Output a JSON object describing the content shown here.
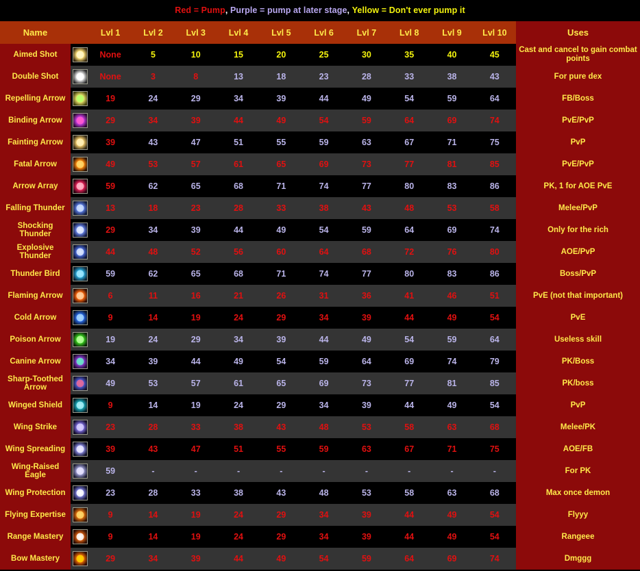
{
  "legend": {
    "parts": [
      {
        "text": "Red = Pump",
        "color": "#e01010"
      },
      {
        "text": ", ",
        "color": "#ffffff"
      },
      {
        "text": "Purple = pump at later stage",
        "color": "#b9a8f0"
      },
      {
        "text": ", ",
        "color": "#ffffff"
      },
      {
        "text": "Yellow = Don't ever pump it",
        "color": "#f3f30e"
      }
    ],
    "full_text": "Red = Pump, Purple = pump at later stage, Yellow = Don't ever pump it"
  },
  "colors": {
    "header_bg": "#a83008",
    "name_col_bg": "#8c0a0a",
    "uses_col_bg": "#8c0a0a",
    "row_dark": "#000000",
    "row_light": "#343434",
    "header_text": "#ffe94a",
    "red": "#e01010",
    "purple": "#b9b3e8",
    "yellow": "#f3f30e"
  },
  "header": {
    "name": "Name",
    "levels": [
      "Lvl 1",
      "Lvl 2",
      "Lvl 3",
      "Lvl 4",
      "Lvl 5",
      "Lvl 6",
      "Lvl 7",
      "Lvl 8",
      "Lvl 9",
      "Lvl 10"
    ],
    "uses": "Uses"
  },
  "rows": [
    {
      "name": "Aimed Shot",
      "icon": "aimed-shot-icon",
      "icon_colors": [
        "#3a2b10",
        "#ffe27a",
        "#fff6c8"
      ],
      "values": [
        "None",
        "5",
        "10",
        "15",
        "20",
        "25",
        "30",
        "35",
        "40",
        "45"
      ],
      "value_colors": [
        "red",
        "yellow",
        "yellow",
        "yellow",
        "yellow",
        "yellow",
        "yellow",
        "yellow",
        "yellow",
        "yellow"
      ],
      "uses": "Cast and cancel to gain combat points"
    },
    {
      "name": "Double Shot",
      "icon": "double-shot-icon",
      "icon_colors": [
        "#2b2b2b",
        "#e8e8e8",
        "#ffffff"
      ],
      "values": [
        "None",
        "3",
        "8",
        "13",
        "18",
        "23",
        "28",
        "33",
        "38",
        "43"
      ],
      "value_colors": [
        "red",
        "red",
        "red",
        "purple",
        "purple",
        "purple",
        "purple",
        "purple",
        "purple",
        "purple"
      ],
      "uses": "For pure dex"
    },
    {
      "name": "Repelling Arrow",
      "icon": "repelling-arrow-icon",
      "icon_colors": [
        "#43400f",
        "#e8e06a",
        "#b6ff6a"
      ],
      "values": [
        "19",
        "24",
        "29",
        "34",
        "39",
        "44",
        "49",
        "54",
        "59",
        "64"
      ],
      "value_colors": [
        "red",
        "purple",
        "purple",
        "purple",
        "purple",
        "purple",
        "purple",
        "purple",
        "purple",
        "purple"
      ],
      "uses": "FB/Boss"
    },
    {
      "name": "Binding Arrow",
      "icon": "binding-arrow-icon",
      "icon_colors": [
        "#2a0a30",
        "#c53de0",
        "#ff5ad0"
      ],
      "values": [
        "29",
        "34",
        "39",
        "44",
        "49",
        "54",
        "59",
        "64",
        "69",
        "74"
      ],
      "value_colors": [
        "red",
        "red",
        "red",
        "red",
        "red",
        "red",
        "red",
        "red",
        "red",
        "red"
      ],
      "uses": "PvE/PvP"
    },
    {
      "name": "Fainting Arrow",
      "icon": "fainting-arrow-icon",
      "icon_colors": [
        "#2f2614",
        "#f0c96a",
        "#fff0b8"
      ],
      "values": [
        "39",
        "43",
        "47",
        "51",
        "55",
        "59",
        "63",
        "67",
        "71",
        "75"
      ],
      "value_colors": [
        "red",
        "purple",
        "purple",
        "purple",
        "purple",
        "purple",
        "purple",
        "purple",
        "purple",
        "purple"
      ],
      "uses": "PvP"
    },
    {
      "name": "Fatal Arrow",
      "icon": "fatal-arrow-icon",
      "icon_colors": [
        "#2a1000",
        "#ff8a10",
        "#ffd86a"
      ],
      "values": [
        "49",
        "53",
        "57",
        "61",
        "65",
        "69",
        "73",
        "77",
        "81",
        "85"
      ],
      "value_colors": [
        "red",
        "red",
        "red",
        "red",
        "red",
        "red",
        "red",
        "red",
        "red",
        "red"
      ],
      "uses": "PvE/PvP"
    },
    {
      "name": "Arrow Array",
      "icon": "arrow-array-icon",
      "icon_colors": [
        "#2a0010",
        "#e8235a",
        "#ffb6c8"
      ],
      "values": [
        "59",
        "62",
        "65",
        "68",
        "71",
        "74",
        "77",
        "80",
        "83",
        "86"
      ],
      "value_colors": [
        "red",
        "purple",
        "purple",
        "purple",
        "purple",
        "purple",
        "purple",
        "purple",
        "purple",
        "purple"
      ],
      "uses": "PK, 1 for AOE PvE"
    },
    {
      "name": "Falling Thunder",
      "icon": "falling-thunder-icon",
      "icon_colors": [
        "#101a38",
        "#5a7ae0",
        "#cfe0ff"
      ],
      "values": [
        "13",
        "18",
        "23",
        "28",
        "33",
        "38",
        "43",
        "48",
        "53",
        "58"
      ],
      "value_colors": [
        "red",
        "red",
        "red",
        "red",
        "red",
        "red",
        "red",
        "red",
        "red",
        "red"
      ],
      "uses": "Melee/PvP"
    },
    {
      "name": "Shocking Thunder",
      "icon": "shocking-thunder-icon",
      "icon_colors": [
        "#0e1438",
        "#6a86ea",
        "#e4ecff"
      ],
      "values": [
        "29",
        "34",
        "39",
        "44",
        "49",
        "54",
        "59",
        "64",
        "69",
        "74"
      ],
      "value_colors": [
        "red",
        "purple",
        "purple",
        "purple",
        "purple",
        "purple",
        "purple",
        "purple",
        "purple",
        "purple"
      ],
      "uses": "Only for the rich"
    },
    {
      "name": "Explosive Thunder",
      "icon": "explosive-thunder-icon",
      "icon_colors": [
        "#0c1230",
        "#4a6ad8",
        "#dce8ff"
      ],
      "values": [
        "44",
        "48",
        "52",
        "56",
        "60",
        "64",
        "68",
        "72",
        "76",
        "80"
      ],
      "value_colors": [
        "red",
        "red",
        "red",
        "red",
        "red",
        "red",
        "red",
        "red",
        "red",
        "red"
      ],
      "uses": "AOE/PvP"
    },
    {
      "name": "Thunder Bird",
      "icon": "thunder-bird-icon",
      "icon_colors": [
        "#0a2030",
        "#2aa8d8",
        "#9fe8ff"
      ],
      "values": [
        "59",
        "62",
        "65",
        "68",
        "71",
        "74",
        "77",
        "80",
        "83",
        "86"
      ],
      "value_colors": [
        "purple",
        "purple",
        "purple",
        "purple",
        "purple",
        "purple",
        "purple",
        "purple",
        "purple",
        "purple"
      ],
      "uses": "Boss/PvP"
    },
    {
      "name": "Flaming Arrow",
      "icon": "flaming-arrow-icon",
      "icon_colors": [
        "#2e0a00",
        "#ff6a10",
        "#ffd0a0"
      ],
      "values": [
        "6",
        "11",
        "16",
        "21",
        "26",
        "31",
        "36",
        "41",
        "46",
        "51"
      ],
      "value_colors": [
        "red",
        "red",
        "red",
        "red",
        "red",
        "red",
        "red",
        "red",
        "red",
        "red"
      ],
      "uses": "PvE (not that important)"
    },
    {
      "name": "Cold Arrow",
      "icon": "cold-arrow-icon",
      "icon_colors": [
        "#061428",
        "#2a6ae8",
        "#a8d8ff"
      ],
      "values": [
        "9",
        "14",
        "19",
        "24",
        "29",
        "34",
        "39",
        "44",
        "49",
        "54"
      ],
      "value_colors": [
        "red",
        "red",
        "red",
        "red",
        "red",
        "red",
        "red",
        "red",
        "red",
        "red"
      ],
      "uses": "PvE"
    },
    {
      "name": "Poison Arrow",
      "icon": "poison-arrow-icon",
      "icon_colors": [
        "#0a2008",
        "#3ad020",
        "#b6ff9a"
      ],
      "values": [
        "19",
        "24",
        "29",
        "34",
        "39",
        "44",
        "49",
        "54",
        "59",
        "64"
      ],
      "value_colors": [
        "purple",
        "purple",
        "purple",
        "purple",
        "purple",
        "purple",
        "purple",
        "purple",
        "purple",
        "purple"
      ],
      "uses": "Useless skill"
    },
    {
      "name": "Canine Arrow",
      "icon": "canine-arrow-icon",
      "icon_colors": [
        "#1a0a2a",
        "#8a3ad0",
        "#6aeac8"
      ],
      "values": [
        "34",
        "39",
        "44",
        "49",
        "54",
        "59",
        "64",
        "69",
        "74",
        "79"
      ],
      "value_colors": [
        "purple",
        "purple",
        "purple",
        "purple",
        "purple",
        "purple",
        "purple",
        "purple",
        "purple",
        "purple"
      ],
      "uses": "PK/Boss"
    },
    {
      "name": "Sharp-Toothed Arrow",
      "icon": "sharp-toothed-arrow-icon",
      "icon_colors": [
        "#14102a",
        "#4a5ad0",
        "#e86a9a"
      ],
      "values": [
        "49",
        "53",
        "57",
        "61",
        "65",
        "69",
        "73",
        "77",
        "81",
        "85"
      ],
      "value_colors": [
        "purple",
        "purple",
        "purple",
        "purple",
        "purple",
        "purple",
        "purple",
        "purple",
        "purple",
        "purple"
      ],
      "uses": "PK/boss"
    },
    {
      "name": "Winged Shield",
      "icon": "winged-shield-icon",
      "icon_colors": [
        "#062028",
        "#1aa8b8",
        "#a8f0f8"
      ],
      "values": [
        "9",
        "14",
        "19",
        "24",
        "29",
        "34",
        "39",
        "44",
        "49",
        "54"
      ],
      "value_colors": [
        "red",
        "purple",
        "purple",
        "purple",
        "purple",
        "purple",
        "purple",
        "purple",
        "purple",
        "purple"
      ],
      "uses": "PvP"
    },
    {
      "name": "Wing Strike",
      "icon": "wing-strike-icon",
      "icon_colors": [
        "#0e0a24",
        "#7a6ad8",
        "#d8d0ff"
      ],
      "values": [
        "23",
        "28",
        "33",
        "38",
        "43",
        "48",
        "53",
        "58",
        "63",
        "68"
      ],
      "value_colors": [
        "red",
        "red",
        "red",
        "red",
        "red",
        "red",
        "red",
        "red",
        "red",
        "red"
      ],
      "uses": "Melee/PK"
    },
    {
      "name": "Wing Spreading",
      "icon": "wing-spreading-icon",
      "icon_colors": [
        "#0a0a1e",
        "#8a8ae0",
        "#eceaff"
      ],
      "values": [
        "39",
        "43",
        "47",
        "51",
        "55",
        "59",
        "63",
        "67",
        "71",
        "75"
      ],
      "value_colors": [
        "red",
        "red",
        "red",
        "red",
        "red",
        "red",
        "red",
        "red",
        "red",
        "red"
      ],
      "uses": "AOE/FB"
    },
    {
      "name": "Wing-Raised Eagle",
      "icon": "wing-raised-eagle-icon",
      "icon_colors": [
        "#1a1a2e",
        "#9a9ad0",
        "#e8e4ff"
      ],
      "values": [
        "59",
        "-",
        "-",
        "-",
        "-",
        "-",
        "-",
        "-",
        "-",
        "-"
      ],
      "value_colors": [
        "purple",
        "dash",
        "dash",
        "dash",
        "dash",
        "dash",
        "dash",
        "dash",
        "dash",
        "dash"
      ],
      "uses": "For PK"
    },
    {
      "name": "Wing Protection",
      "icon": "wing-protection-icon",
      "icon_colors": [
        "#0c0c24",
        "#7a7ad8",
        "#ffffff"
      ],
      "values": [
        "23",
        "28",
        "33",
        "38",
        "43",
        "48",
        "53",
        "58",
        "63",
        "68"
      ],
      "value_colors": [
        "purple",
        "purple",
        "purple",
        "purple",
        "purple",
        "purple",
        "purple",
        "purple",
        "purple",
        "purple"
      ],
      "uses": "Max once demon"
    },
    {
      "name": "Flying Expertise",
      "icon": "flying-expertise-icon",
      "icon_colors": [
        "#301000",
        "#e07010",
        "#ffd86a"
      ],
      "values": [
        "9",
        "14",
        "19",
        "24",
        "29",
        "34",
        "39",
        "44",
        "49",
        "54"
      ],
      "value_colors": [
        "red",
        "red",
        "red",
        "red",
        "red",
        "red",
        "red",
        "red",
        "red",
        "red"
      ],
      "uses": "Flyyy"
    },
    {
      "name": "Range Mastery",
      "icon": "range-mastery-icon",
      "icon_colors": [
        "#2a0c00",
        "#d05a10",
        "#ffffff"
      ],
      "values": [
        "9",
        "14",
        "19",
        "24",
        "29",
        "34",
        "39",
        "44",
        "49",
        "54"
      ],
      "value_colors": [
        "red",
        "red",
        "red",
        "red",
        "red",
        "red",
        "red",
        "red",
        "red",
        "red"
      ],
      "uses": "Rangeee"
    },
    {
      "name": "Bow Mastery",
      "icon": "bow-mastery-icon",
      "icon_colors": [
        "#2a0800",
        "#e86a08",
        "#ffd000"
      ],
      "values": [
        "29",
        "34",
        "39",
        "44",
        "49",
        "54",
        "59",
        "64",
        "69",
        "74"
      ],
      "value_colors": [
        "red",
        "red",
        "red",
        "red",
        "red",
        "red",
        "red",
        "red",
        "red",
        "red"
      ],
      "uses": "Dmggg"
    }
  ]
}
